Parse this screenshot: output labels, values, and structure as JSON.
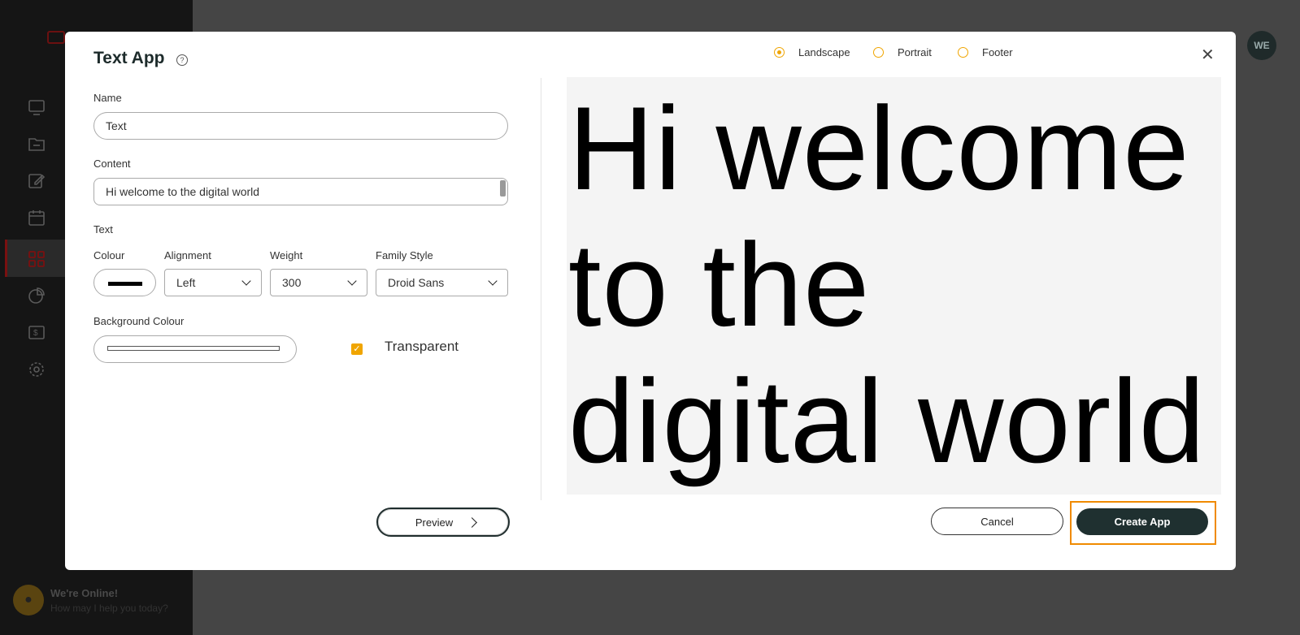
{
  "sidebar": {
    "chat_title": "We're Online!",
    "chat_subtitle": "How may I help you today?"
  },
  "header": {
    "avatar_initials": "WE"
  },
  "modal": {
    "title": "Text App",
    "orientation": {
      "options": [
        "Landscape",
        "Portrait",
        "Footer"
      ],
      "selected": "Landscape"
    },
    "name": {
      "label": "Name",
      "value": "Text"
    },
    "content": {
      "label": "Content",
      "value": "Hi welcome to the digital  world"
    },
    "text_section": {
      "label": "Text"
    },
    "colour": {
      "label": "Colour",
      "value": "#000000"
    },
    "alignment": {
      "label": "Alignment",
      "value": "Left"
    },
    "weight": {
      "label": "Weight",
      "value": "300"
    },
    "family": {
      "label": "Family Style",
      "value": "Droid Sans"
    },
    "background": {
      "label": "Background Colour",
      "transparent_label": "Transparent",
      "transparent_checked": true
    },
    "preview_text": "Hi welcome to the digital world",
    "buttons": {
      "preview": "Preview",
      "cancel": "Cancel",
      "create": "Create App"
    },
    "accent_color": "#f0a500",
    "primary_color": "#1f3030",
    "highlight_color": "#f08a00"
  }
}
